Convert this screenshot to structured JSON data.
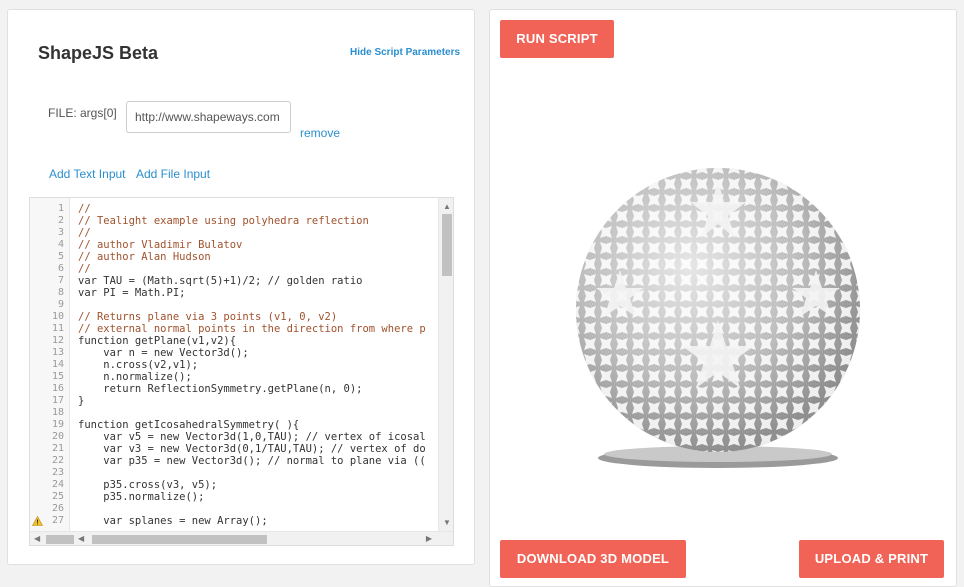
{
  "header": {
    "title": "ShapeJS Beta",
    "hide_params_label": "Hide Script Parameters"
  },
  "params": {
    "file_label": "FILE: args[0]",
    "file_value": "http://www.shapeways.com",
    "remove_label": "remove",
    "add_text_label": "Add Text Input",
    "add_file_label": "Add File Input"
  },
  "editor": {
    "lines": [
      {
        "n": "1",
        "t": "//"
      },
      {
        "n": "2",
        "t": "// Tealight example using polyhedra reflection"
      },
      {
        "n": "3",
        "t": "//"
      },
      {
        "n": "4",
        "t": "// author Vladimir Bulatov"
      },
      {
        "n": "5",
        "t": "// author Alan Hudson"
      },
      {
        "n": "6",
        "t": "//"
      },
      {
        "n": "7",
        "t": "var TAU = (Math.sqrt(5)+1)/2; // golden ratio"
      },
      {
        "n": "8",
        "t": "var PI = Math.PI;"
      },
      {
        "n": "9",
        "t": ""
      },
      {
        "n": "10",
        "t": "// Returns plane via 3 points (v1, 0, v2)"
      },
      {
        "n": "11",
        "t": "// external normal points in the direction from where p"
      },
      {
        "n": "12",
        "t": "function getPlane(v1,v2){"
      },
      {
        "n": "13",
        "t": "    var n = new Vector3d();"
      },
      {
        "n": "14",
        "t": "    n.cross(v2,v1);"
      },
      {
        "n": "15",
        "t": "    n.normalize();"
      },
      {
        "n": "16",
        "t": "    return ReflectionSymmetry.getPlane(n, 0);"
      },
      {
        "n": "17",
        "t": "}"
      },
      {
        "n": "18",
        "t": ""
      },
      {
        "n": "19",
        "t": "function getIcosahedralSymmetry( ){"
      },
      {
        "n": "20",
        "t": "    var v5 = new Vector3d(1,0,TAU); // vertex of icosal"
      },
      {
        "n": "21",
        "t": "    var v3 = new Vector3d(0,1/TAU,TAU); // vertex of do"
      },
      {
        "n": "22",
        "t": "    var p35 = new Vector3d(); // normal to plane via (("
      },
      {
        "n": "23",
        "t": ""
      },
      {
        "n": "24",
        "t": "    p35.cross(v3, v5);"
      },
      {
        "n": "25",
        "t": "    p35.normalize();"
      },
      {
        "n": "26",
        "t": ""
      },
      {
        "n": "27",
        "t": "    var splanes = new Array();"
      }
    ]
  },
  "actions": {
    "run_label": "RUN SCRIPT",
    "download_label": "DOWNLOAD 3D MODEL",
    "upload_label": "UPLOAD & PRINT"
  },
  "colors": {
    "accent": "#f26357",
    "link": "#2a8fd0"
  }
}
